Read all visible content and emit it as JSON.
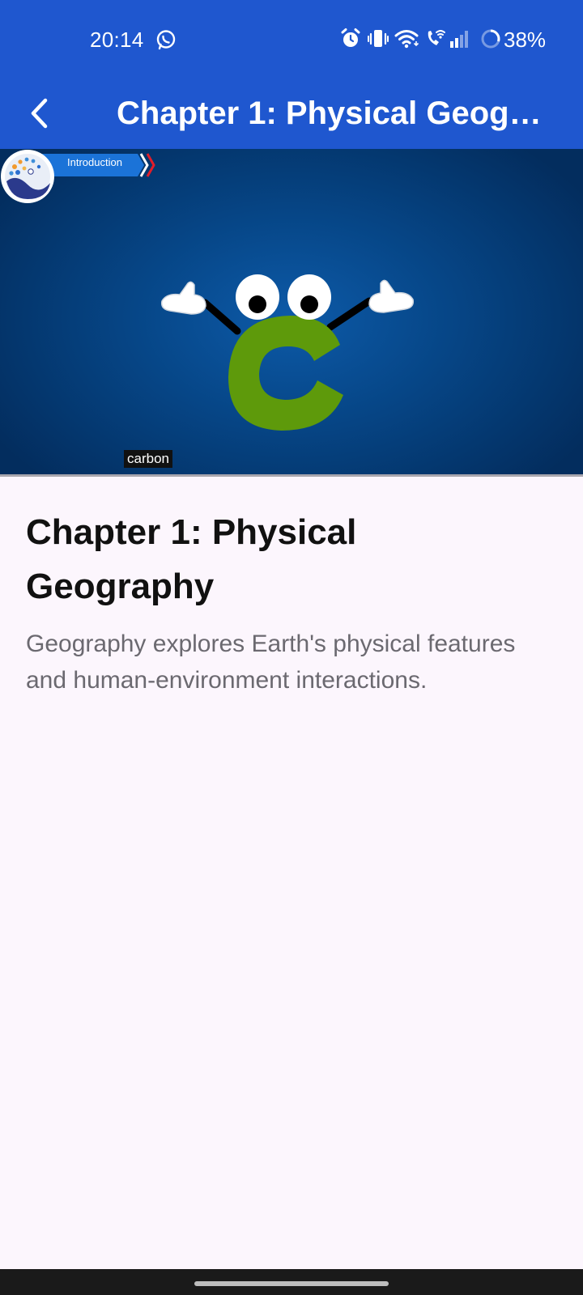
{
  "status_bar": {
    "time": "20:14",
    "notification_icon": "whatsapp-icon",
    "icons": [
      "alarm-icon",
      "vibrate-icon",
      "wifi-icon",
      "wifi-calling-icon",
      "signal-icon",
      "battery-icon"
    ],
    "battery": "38%",
    "battery_level": 0.38
  },
  "app_bar": {
    "back_icon": "chevron-left-icon",
    "title": "Chapter 1: Physical Geography",
    "background": "#1f57cf"
  },
  "video": {
    "intro_label": "Introduction",
    "caption": "carbon",
    "mascot_letter": "C",
    "mascot_color": "#5e9a0b",
    "background": "#064687"
  },
  "content": {
    "title": "Chapter 1: Physical Geography",
    "description": "Geography explores Earth's physical features and human-environment interactions."
  },
  "colors": {
    "page_background": "#fcf6fd",
    "description_text": "#6b6970"
  }
}
